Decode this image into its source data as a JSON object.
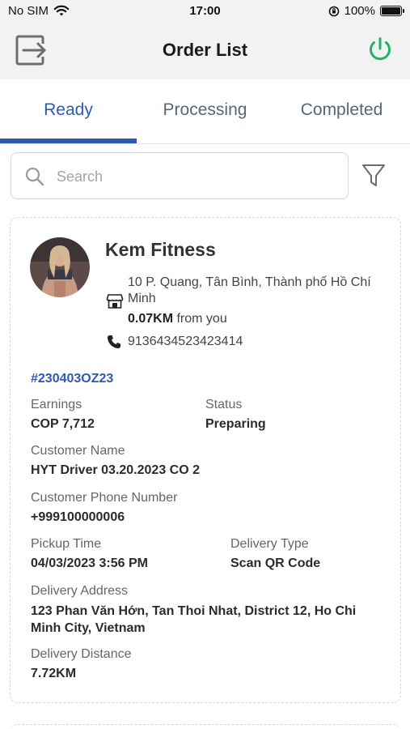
{
  "status_bar": {
    "carrier": "No SIM",
    "time": "17:00",
    "battery": "100%"
  },
  "header": {
    "title": "Order List"
  },
  "tabs": [
    {
      "label": "Ready",
      "active": true
    },
    {
      "label": "Processing",
      "active": false
    },
    {
      "label": "Completed",
      "active": false
    }
  ],
  "search": {
    "placeholder": "Search",
    "value": ""
  },
  "colors": {
    "accent": "#2f58b6",
    "power": "#1db368"
  },
  "order": {
    "shop_name": "Kem Fitness",
    "address": "10 P. Quang, Tân Bình, Thành phố Hồ Chí Minh",
    "distance_value": "0.07KM",
    "distance_suffix": "from you",
    "phone": "9136434523423414",
    "order_id": "#230403OZ23",
    "earnings_label": "Earnings",
    "earnings_value": "COP 7,712",
    "status_label": "Status",
    "status_value": "Preparing",
    "customer_name_label": "Customer Name",
    "customer_name_value": "HYT Driver 03.20.2023 CO 2",
    "customer_phone_label": "Customer Phone Number",
    "customer_phone_value": "+999100000006",
    "pickup_time_label": "Pickup Time",
    "pickup_time_value": "04/03/2023 3:56 PM",
    "delivery_type_label": "Delivery Type",
    "delivery_type_value": "Scan QR Code",
    "delivery_address_label": "Delivery Address",
    "delivery_address_value": "123 Phan Văn Hớn, Tan Thoi Nhat, District 12, Ho Chi Minh City, Vietnam",
    "delivery_distance_label": "Delivery Distance",
    "delivery_distance_value": "7.72KM"
  },
  "icons": [
    "wifi-icon",
    "orientation-lock-icon",
    "battery-icon",
    "logout-icon",
    "power-icon",
    "search-icon",
    "filter-icon",
    "store-icon",
    "phone-icon"
  ]
}
